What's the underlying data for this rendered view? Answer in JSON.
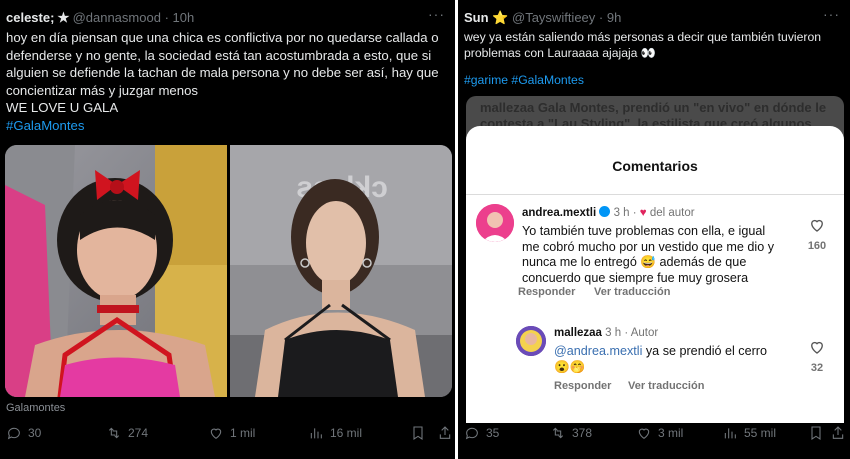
{
  "left_post": {
    "display_name": "celeste; ✭",
    "handle": "@dannasmood",
    "time": "10h",
    "text_lines": [
      "hoy en día piensan que una chica es conflictiva por no quedarse callada o",
      "defenderse y no gente, la sociedad está tan acostumbrada a esto, que si",
      "alguien se defiende la tachan de mala persona y no debe ser así, hay que",
      "concientizar más y juzgar menos",
      "WE LOVE U GALA"
    ],
    "hashtag": "#GalaMontes",
    "image_source": "Galamontes",
    "image_right_sign": "cklass",
    "stats": {
      "replies": "30",
      "reposts": "274",
      "likes": "1 mil",
      "views": "16 mil"
    }
  },
  "right_post": {
    "display_name": "Sun",
    "star": "⭐",
    "handle": "@Tayswiftieey",
    "time": "9h",
    "text_lines": [
      "wey ya están saliendo más personas a decir que también tuvieron",
      "problemas con Lauraaaa ajajaja 👀"
    ],
    "hashtags": [
      "#garime",
      "#GalaMontes"
    ],
    "quoted_text_lines": [
      "mallezaa Gala Montes, prendió un \"en vivo\" en dónde le",
      "contesta a \"Lau Styling\", la estilista que creó algunos"
    ],
    "comments_title": "Comentarios",
    "comments": [
      {
        "user": "andrea.mextli",
        "meta": "3 h ·",
        "liked_by_author": "del autor",
        "text_lines": [
          "Yo también tuve problemas con ella, e igual",
          "me cobró mucho por un vestido que me dio y",
          "nunca me lo entregó 😅 además de que",
          "concuerdo que siempre fue muy grosera"
        ],
        "reply_label": "Responder",
        "translate_label": "Ver traducción",
        "likes": "160"
      },
      {
        "user": "mallezaa",
        "meta": "3 h · Autor",
        "mention": "@andrea.mextli",
        "text_rest": " ya se prendió el cerro",
        "emojis": "😮🤭",
        "reply_label": "Responder",
        "translate_label": "Ver traducción",
        "likes": "32"
      }
    ],
    "stats": {
      "replies": "35",
      "reposts": "378",
      "likes": "3 mil",
      "views": "55 mil"
    }
  },
  "colors": {
    "link": "#1d9bf0",
    "muted": "#71767b",
    "heart_red": "#e0245e",
    "star": "#f5b50a"
  },
  "icons": [
    "reply-icon",
    "repost-icon",
    "like-icon",
    "views-icon",
    "bookmark-icon",
    "share-icon",
    "more-icon",
    "verified-icon",
    "heart-outline-icon"
  ]
}
